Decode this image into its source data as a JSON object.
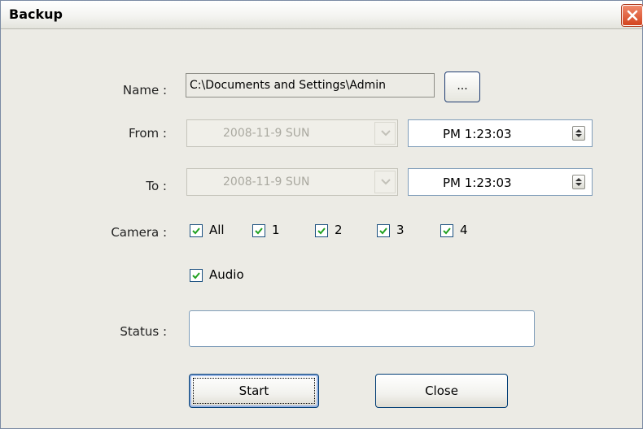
{
  "window": {
    "title": "Backup",
    "close_icon": "close-icon"
  },
  "form": {
    "name_label": "Name :",
    "name_value": "C:\\Documents and Settings\\Admin",
    "browse_label": "...",
    "from_label": "From :",
    "from_date": "2008-11-9   SUN",
    "from_time": "PM  1:23:03",
    "to_label": "To :",
    "to_date": "2008-11-9   SUN",
    "to_time": "PM  1:23:03",
    "camera_label": "Camera :",
    "cameras": [
      {
        "label": "All",
        "checked": true
      },
      {
        "label": "1",
        "checked": true
      },
      {
        "label": "2",
        "checked": true
      },
      {
        "label": "3",
        "checked": true
      },
      {
        "label": "4",
        "checked": true
      }
    ],
    "audio": {
      "label": "Audio",
      "checked": true
    },
    "status_label": "Status :",
    "status_value": ""
  },
  "buttons": {
    "start": "Start",
    "close": "Close"
  },
  "colors": {
    "check": "#21a121",
    "accent_border": "#003c74",
    "close_red": "#d3441f"
  }
}
